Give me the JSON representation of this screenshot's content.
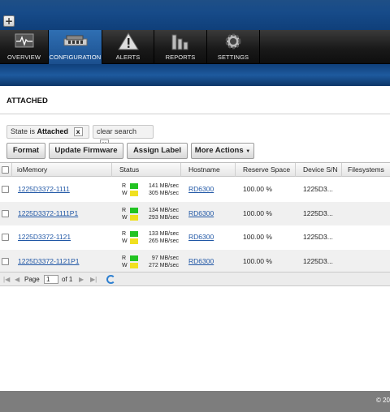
{
  "nav": {
    "items": [
      {
        "label": "OVERVIEW",
        "icon": "overview-icon"
      },
      {
        "label": "CONFIGURATION",
        "icon": "configuration-icon"
      },
      {
        "label": "ALERTS",
        "icon": "alert-icon"
      },
      {
        "label": "REPORTS",
        "icon": "reports-icon"
      },
      {
        "label": "SETTINGS",
        "icon": "settings-gear-icon"
      }
    ],
    "active": "CONFIGURATION"
  },
  "page": {
    "title": "ATTACHED"
  },
  "filters": {
    "state_prefix": "State is",
    "state_value": "Attached",
    "clear_label": "clear search",
    "remove_glyph": "x"
  },
  "toolbar": {
    "format": "Format",
    "update_firmware": "Update Firmware",
    "assign_label": "Assign Label",
    "more_actions": "More Actions"
  },
  "table": {
    "columns": [
      "ioMemory",
      "Status",
      "Hostname",
      "Reserve Space",
      "Device S/N",
      "Filesystems"
    ],
    "rows": [
      {
        "iomemory": "1225D3372-1111",
        "r_label": "R",
        "w_label": "W",
        "read": "141 MB/sec",
        "write": "305 MB/sec",
        "hostname": "RD6300",
        "reserve": "100.00 %",
        "sn": "1225D3...",
        "fs": ""
      },
      {
        "iomemory": "1225D3372-1111P1",
        "r_label": "R",
        "w_label": "W",
        "read": "134 MB/sec",
        "write": "293 MB/sec",
        "hostname": "RD6300",
        "reserve": "100.00 %",
        "sn": "1225D3...",
        "fs": ""
      },
      {
        "iomemory": "1225D3372-1121",
        "r_label": "R",
        "w_label": "W",
        "read": "133 MB/sec",
        "write": "265 MB/sec",
        "hostname": "RD6300",
        "reserve": "100.00 %",
        "sn": "1225D3...",
        "fs": ""
      },
      {
        "iomemory": "1225D3372-1121P1",
        "r_label": "R",
        "w_label": "W",
        "read": "97 MB/sec",
        "write": "272 MB/sec",
        "hostname": "RD6300",
        "reserve": "100.00 %",
        "sn": "1225D3...",
        "fs": ""
      }
    ]
  },
  "pager": {
    "page_label": "Page",
    "page_value": "1",
    "of_label": "of 1"
  },
  "footer": {
    "copyright": "© 20"
  },
  "colors": {
    "read": "#22c322",
    "write": "#f0e020",
    "accent": "#1e5a9e"
  }
}
